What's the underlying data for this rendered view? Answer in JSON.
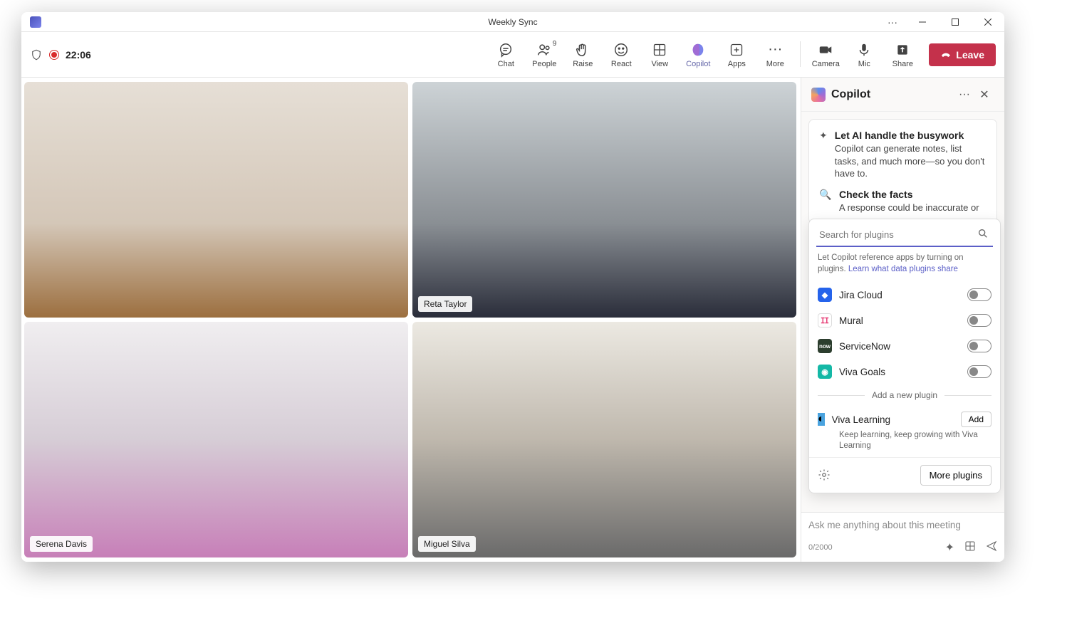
{
  "titlebar": {
    "title": "Weekly Sync"
  },
  "toolbar": {
    "time": "22:06",
    "buttons": {
      "chat": "Chat",
      "people": "People",
      "people_count": "9",
      "raise": "Raise",
      "react": "React",
      "view": "View",
      "copilot": "Copilot",
      "apps": "Apps",
      "more": "More",
      "camera": "Camera",
      "mic": "Mic",
      "share": "Share"
    },
    "leave": "Leave"
  },
  "participants": [
    {
      "name": ""
    },
    {
      "name": "Reta Taylor"
    },
    {
      "name": "Serena Davis"
    },
    {
      "name": "Miguel Silva"
    }
  ],
  "copilot": {
    "title": "Copilot",
    "info": [
      {
        "title": "Let AI handle the busywork",
        "desc": "Copilot can generate notes, list tasks, and much more—so you don't have to."
      },
      {
        "title": "Check the facts",
        "desc": "A response could be inaccurate or"
      }
    ],
    "search_placeholder": "Search for plugins",
    "hint_text": "Let Copilot reference apps by turning on plugins.  ",
    "hint_link": "Learn what data plugins share",
    "plugins": [
      {
        "name": "Jira Cloud",
        "color": "#2563eb"
      },
      {
        "name": "Mural",
        "color": "#ffffff"
      },
      {
        "name": "ServiceNow",
        "color": "#2c3e2e"
      },
      {
        "name": "Viva Goals",
        "color": "#14b8a6"
      }
    ],
    "divider": "Add a new plugin",
    "suggestion": {
      "name": "Viva Learning",
      "desc": "Keep learning, keep growing with Viva Learning",
      "add": "Add"
    },
    "more_plugins": "More plugins",
    "compose_placeholder": "Ask me anything about this meeting",
    "char_count": "0/2000"
  }
}
